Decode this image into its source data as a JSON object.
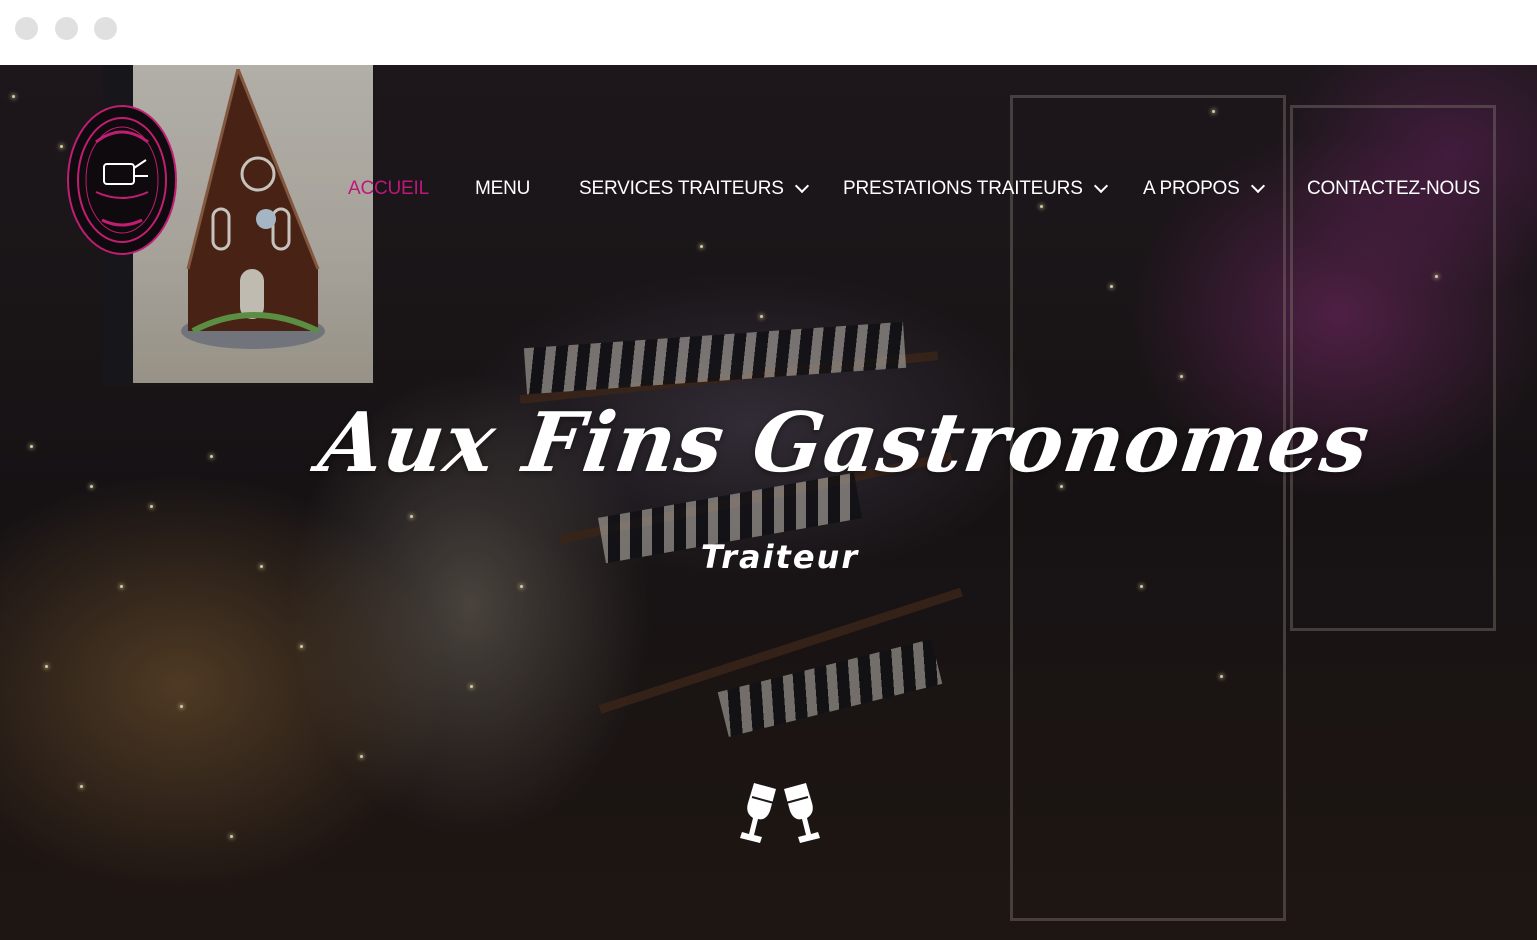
{
  "window": {
    "controls": [
      "close",
      "minimize",
      "maximize"
    ]
  },
  "brand": {
    "logo_icon": "aux-fins-gastronomes-logo"
  },
  "nav": {
    "items": [
      {
        "label": "ACCUEIL",
        "active": true,
        "dropdown": false
      },
      {
        "label": "MENU",
        "active": false,
        "dropdown": false
      },
      {
        "label": "SERVICES TRAITEURS",
        "active": false,
        "dropdown": true
      },
      {
        "label": "PRESTATIONS TRAITEURS",
        "active": false,
        "dropdown": true
      },
      {
        "label": "A PROPOS",
        "active": false,
        "dropdown": true
      },
      {
        "label": "CONTACTEZ-NOUS",
        "active": false,
        "dropdown": false
      }
    ],
    "active_color": "#c0167a"
  },
  "hero": {
    "title": "Aux Fins Gastronomes",
    "subtitle": "Traiteur",
    "icon": "champagne-glasses-icon"
  },
  "colors": {
    "accent": "#c0167a",
    "text": "#ffffff"
  }
}
